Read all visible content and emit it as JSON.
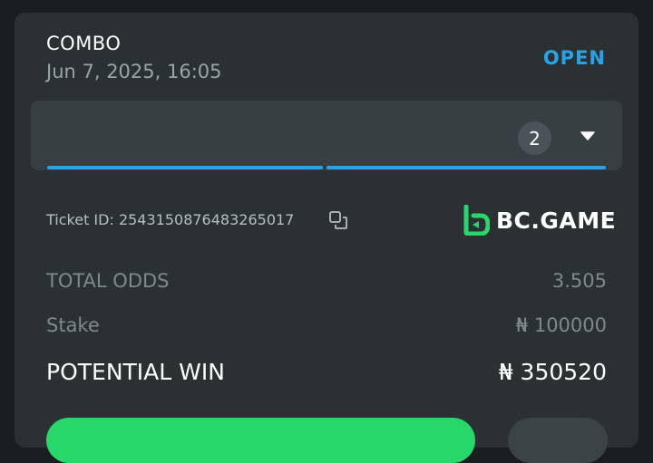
{
  "bet": {
    "type": "COMBO",
    "date": "Jun 7, 2025, 16:05",
    "status": "OPEN",
    "selection_count": "2"
  },
  "ticket": {
    "label": "Ticket ID: 2543150876483265017"
  },
  "brand": {
    "name": "BC.GAME",
    "accent": "#27d76a"
  },
  "summary": {
    "total_odds_label": "TOTAL ODDS",
    "total_odds_value": "3.505",
    "stake_label": "Stake",
    "stake_value": "₦ 100000",
    "potential_win_label": "POTENTIAL WIN",
    "potential_win_value": "₦ 350520"
  },
  "colors": {
    "status_blue": "#2aa3e6",
    "card_bg": "#2b3133",
    "page_bg": "#1a1e20"
  },
  "icons": {
    "expand": "chevron-down-icon",
    "copy": "copy-icon",
    "logo": "bc-game-logo-icon"
  }
}
